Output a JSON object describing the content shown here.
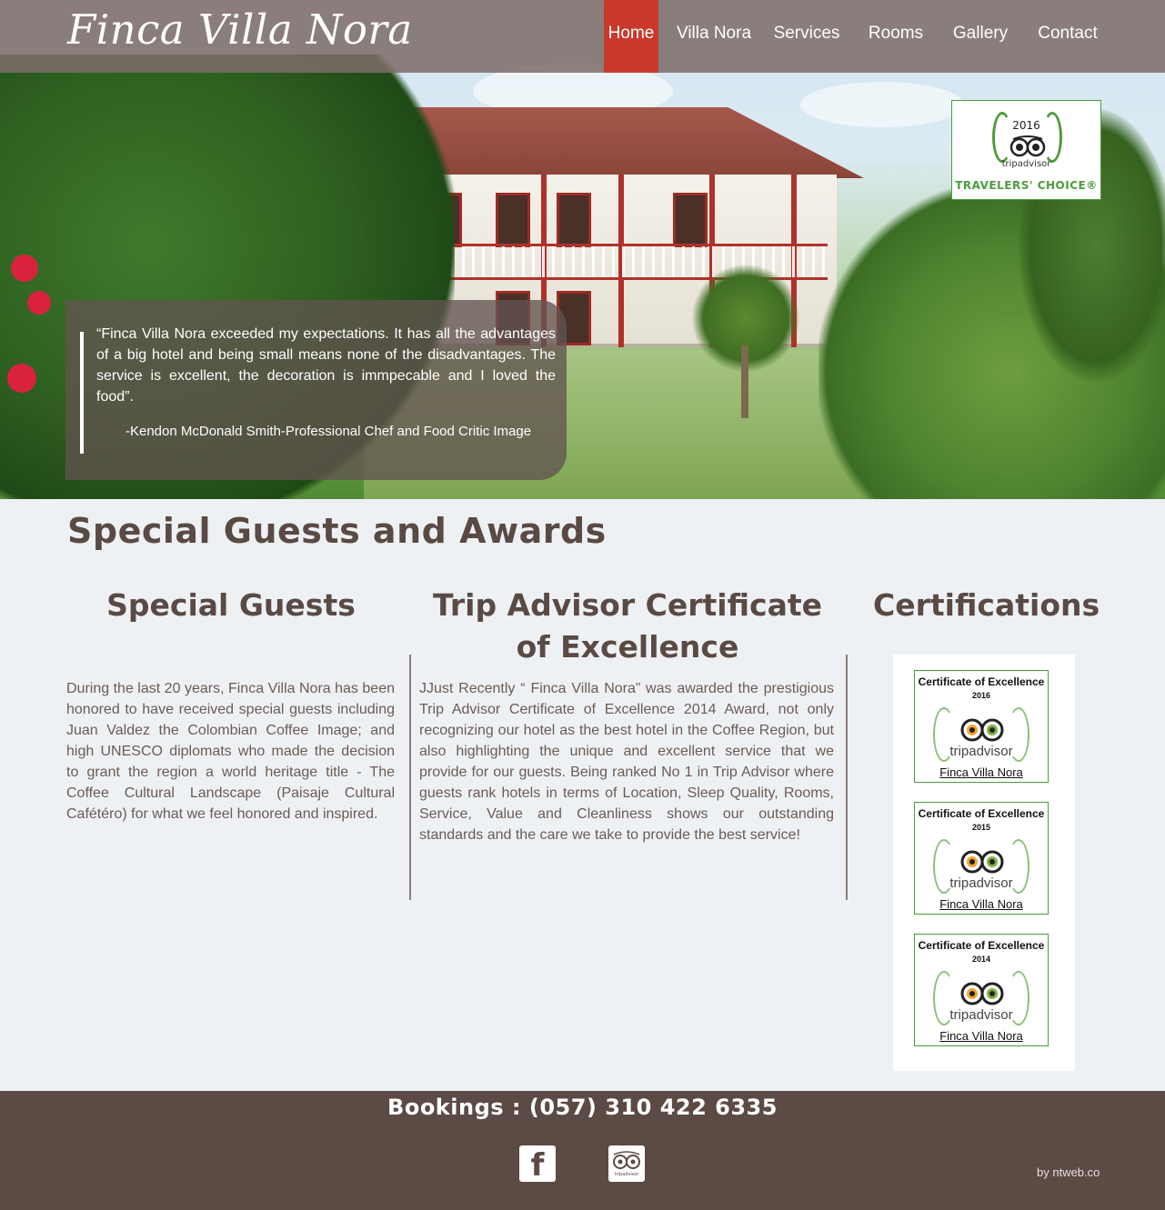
{
  "site": {
    "logo": "Finca Villa Nora"
  },
  "nav": {
    "items": [
      {
        "label": "Home",
        "active": true
      },
      {
        "label": "Villa Nora",
        "active": false
      },
      {
        "label": "Services",
        "active": false
      },
      {
        "label": "Rooms",
        "active": false
      },
      {
        "label": "Gallery",
        "active": false
      },
      {
        "label": "Contact",
        "active": false
      }
    ]
  },
  "hero": {
    "quote": "“Finca Villa Nora exceeded my expectations. It has all the advantages of a big hotel and being small means none of the disadvantages. The service is excellent, the decoration is immpecable and I loved the food”.",
    "author": "-Kendon McDonald Smith-Professional Chef and Food Critic Image"
  },
  "award_badge": {
    "year": "2016",
    "brand": "tripadvisor",
    "label": "TRAVELERS' CHOICE®",
    "icon": "tripadvisor-owl-icon"
  },
  "main": {
    "section_title": "Special Guests and Awards",
    "columns": [
      {
        "title": "Special Guests",
        "text": "During the last 20 years, Finca Villa Nora has been honored to have received special guests including Juan Valdez the Colombian Coffee Image; and high UNESCO diplomats who made the decision to grant the region a world heritage title - The Coffee Cultural Landscape (Paisaje Cultural Cafétéro) for what we feel honored and inspired."
      },
      {
        "title": "Trip Advisor Certificate of Excellence",
        "text": "JJust Recently “ Finca Villa Nora” was awarded the prestigious Trip Advisor Certificate of Excellence 2014 Award, not only recognizing our hotel as the best hotel in the Coffee Region, but also highlighting the unique and excellent service that we provide for our guests. Being ranked No 1 in Trip Advisor where guests rank hotels in terms of Location, Sleep Quality, Rooms, Service, Value and Cleanliness shows our outstanding standards and the care we take to provide the best service!"
      },
      {
        "title": "Certifications"
      }
    ],
    "certificates": [
      {
        "title": "Certificate of Excellence",
        "year": "2016",
        "brand": "tripadvisor",
        "link": "Finca Villa Nora"
      },
      {
        "title": "Certificate of Excellence",
        "year": "2015",
        "brand": "tripadvisor",
        "link": "Finca Villa Nora"
      },
      {
        "title": "Certificate of Excellence",
        "year": "2014",
        "brand": "tripadvisor",
        "link": "Finca Villa Nora"
      }
    ]
  },
  "footer": {
    "bookings": "Bookings : (057) 310 422 6335",
    "social": [
      {
        "icon": "facebook-icon",
        "glyph": "f"
      },
      {
        "icon": "tripadvisor-icon",
        "glyph": "tripadvisor"
      }
    ],
    "credit": "by ntweb.co"
  },
  "colors": {
    "nav_bg": "#7e6c69",
    "nav_active": "#c8392b",
    "heading": "#5a4a44",
    "footer_bg": "#5c4a44",
    "tripadvisor_green": "#4e9b3e",
    "page_bg": "#eef1f4"
  }
}
